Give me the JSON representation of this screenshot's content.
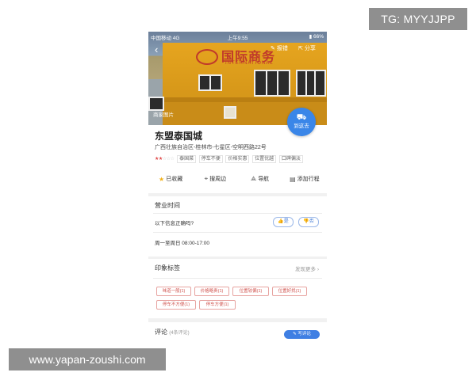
{
  "watermarks": {
    "top": "TG: MYYJJPP",
    "bottom": "www.yapan-zoushi.com"
  },
  "status_bar": {
    "carrier": "中国移动  4G",
    "time": "上午9:55",
    "battery": "66%"
  },
  "header": {
    "back_icon": "chevron-left-icon",
    "report_label": "报错",
    "share_label": "分享"
  },
  "photo": {
    "sign_text": "国际商务",
    "sign_sub": "INTERNATIONAL",
    "photo_label": "商家图片"
  },
  "goto_button": {
    "label": "到这去",
    "icon": "car-icon",
    "color": "#3a86e8"
  },
  "place": {
    "name": "东盟泰国城",
    "address": "广西壮族自治区-桂林市-七星区-空明西路22号",
    "rating_stars": "★★",
    "rating_empty": "☆☆☆",
    "rating_value": 2,
    "tags": [
      "泰国菜",
      "停车不便",
      "价格实惠",
      "位置优越",
      "口碑偏淡"
    ]
  },
  "actions": [
    {
      "icon": "star-icon",
      "label": "已收藏"
    },
    {
      "icon": "location-pin-icon",
      "label": "搜周边"
    },
    {
      "icon": "navigation-icon",
      "label": "导航"
    },
    {
      "icon": "calendar-icon",
      "label": "添加行程"
    }
  ],
  "hours": {
    "title": "营业时间",
    "question": "以下信息正确吗?",
    "yes_label": "是",
    "no_label": "否",
    "schedule": "周一至周日 08:00-17:00"
  },
  "impressions": {
    "title": "印象标签",
    "more_label": "发现更多",
    "tags": [
      "味道一般(1)",
      "价格略贵(1)",
      "位置较偏(1)",
      "位置好找(1)",
      "停车不方便(1)",
      "停车方便(1)"
    ]
  },
  "reviews": {
    "title": "评论",
    "count_label": "(4条评论)",
    "write_label": "写评论"
  },
  "colors": {
    "accent": "#3a86e8",
    "tag_red": "#d0544f",
    "building_orange": "#e6a51f"
  }
}
